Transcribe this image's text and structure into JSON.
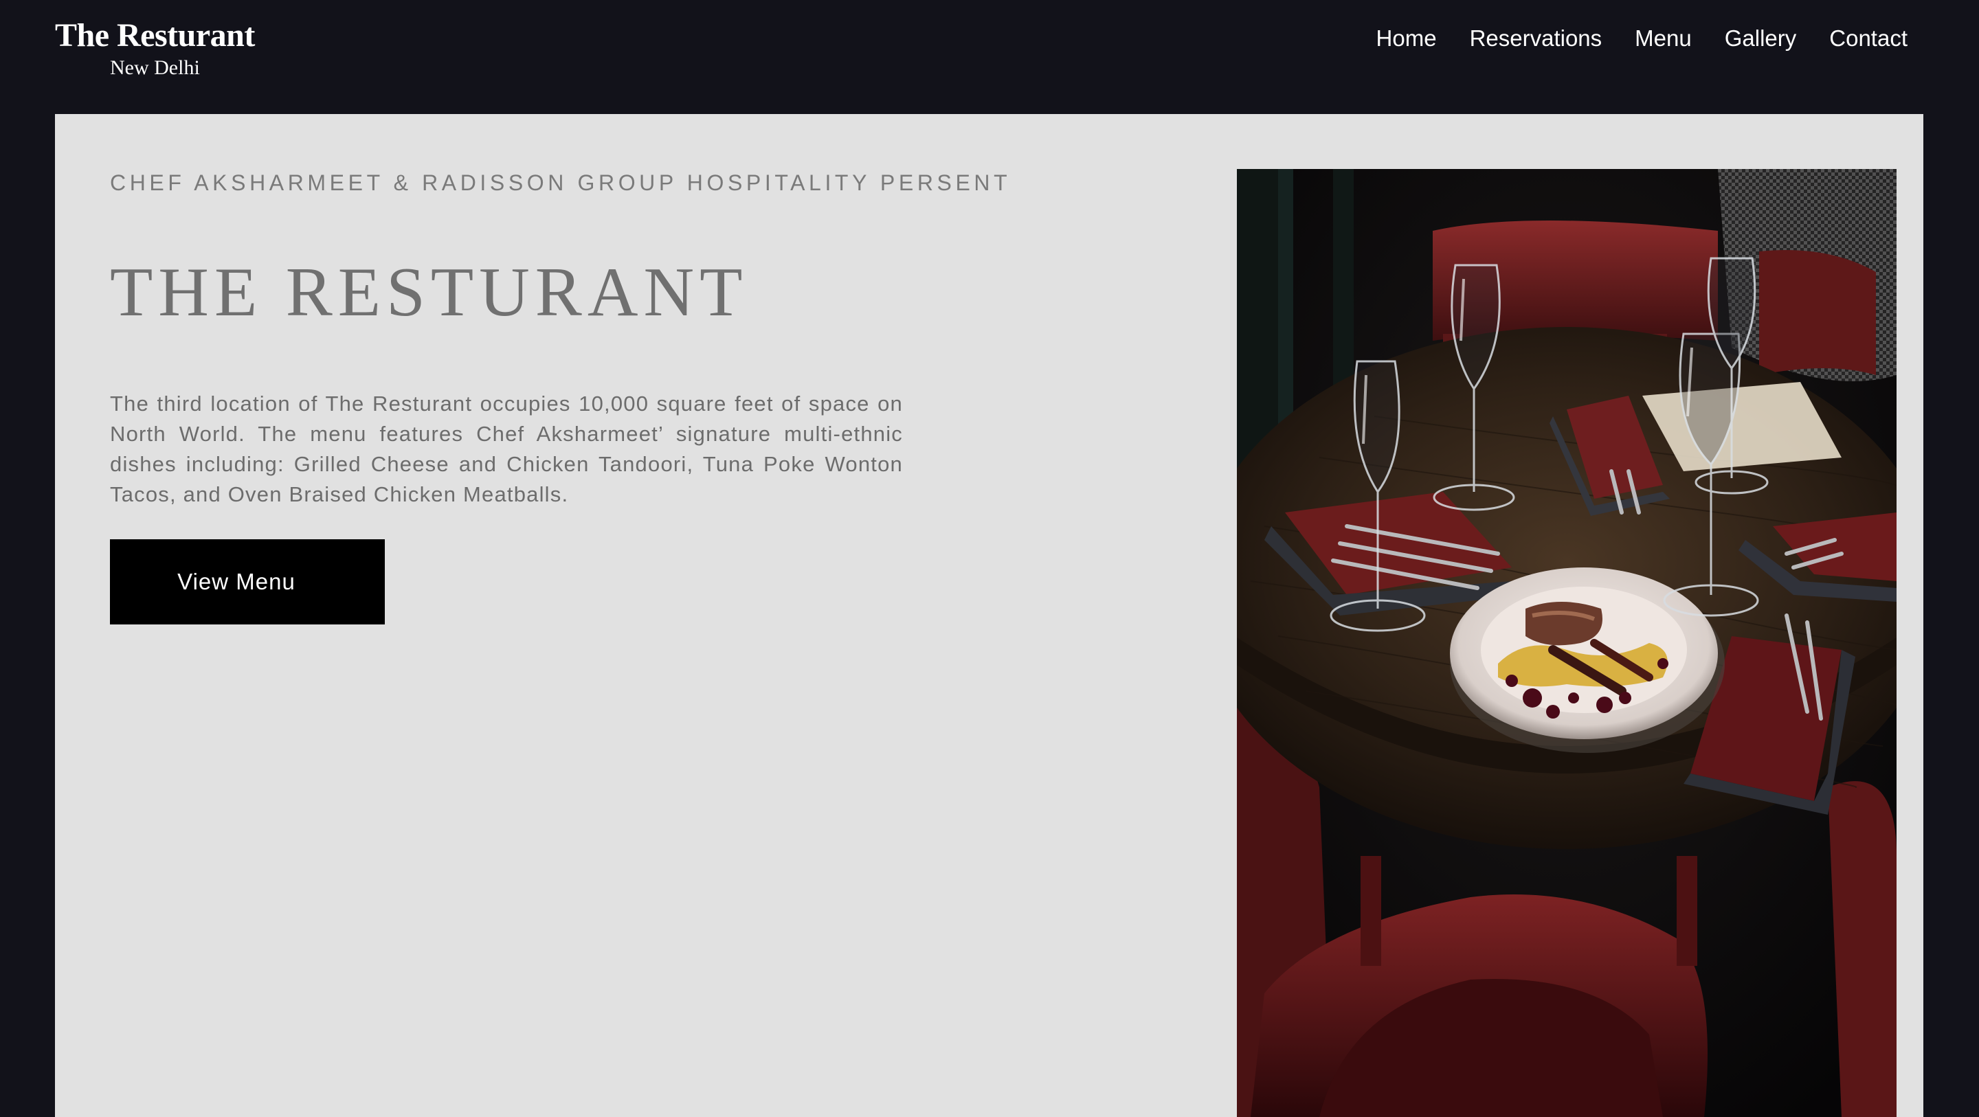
{
  "header": {
    "brand_name": "The Resturant",
    "brand_city": "New Delhi",
    "nav": [
      "Home",
      "Reservations",
      "Menu",
      "Gallery",
      "Contact"
    ]
  },
  "hero": {
    "tagline": "CHEF AKSHARMEET & RADISSON GROUP HOSPITALITY PERSENT",
    "title": "THE RESTURANT",
    "description": "The third location of The Resturant occupies 10,000 square feet of space on North World. The menu features Chef Aksharmeet’ signature multi-ethnic dishes including: Grilled Cheese and Chicken Tandoori, Tuna Poke Wonton Tacos, and Oven Braised Chicken Meatballs.",
    "button_label": "View Menu"
  },
  "colors": {
    "header_bg": "#12121a",
    "content_bg": "#e1e1e1",
    "button_bg": "#000000",
    "text_gray": "#707070"
  }
}
